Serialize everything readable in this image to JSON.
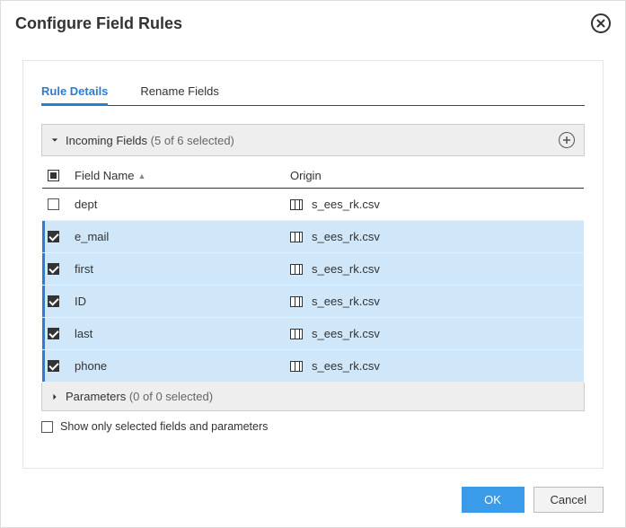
{
  "dialog": {
    "title": "Configure Field Rules"
  },
  "tabs": {
    "rule_details": "Rule Details",
    "rename_fields": "Rename Fields"
  },
  "incoming": {
    "label": "Incoming Fields",
    "count_text": "(5 of 6 selected)"
  },
  "columns": {
    "field_name": "Field Name",
    "origin": "Origin"
  },
  "rows": [
    {
      "name": "dept",
      "origin": "s_ees_rk.csv",
      "selected": false
    },
    {
      "name": "e_mail",
      "origin": "s_ees_rk.csv",
      "selected": true
    },
    {
      "name": "first",
      "origin": "s_ees_rk.csv",
      "selected": true
    },
    {
      "name": "ID",
      "origin": "s_ees_rk.csv",
      "selected": true
    },
    {
      "name": "last",
      "origin": "s_ees_rk.csv",
      "selected": true
    },
    {
      "name": "phone",
      "origin": "s_ees_rk.csv",
      "selected": true
    }
  ],
  "parameters": {
    "label": "Parameters",
    "count_text": "(0 of 0 selected)"
  },
  "filter": {
    "label": "Show only selected fields and parameters"
  },
  "buttons": {
    "ok": "OK",
    "cancel": "Cancel"
  }
}
